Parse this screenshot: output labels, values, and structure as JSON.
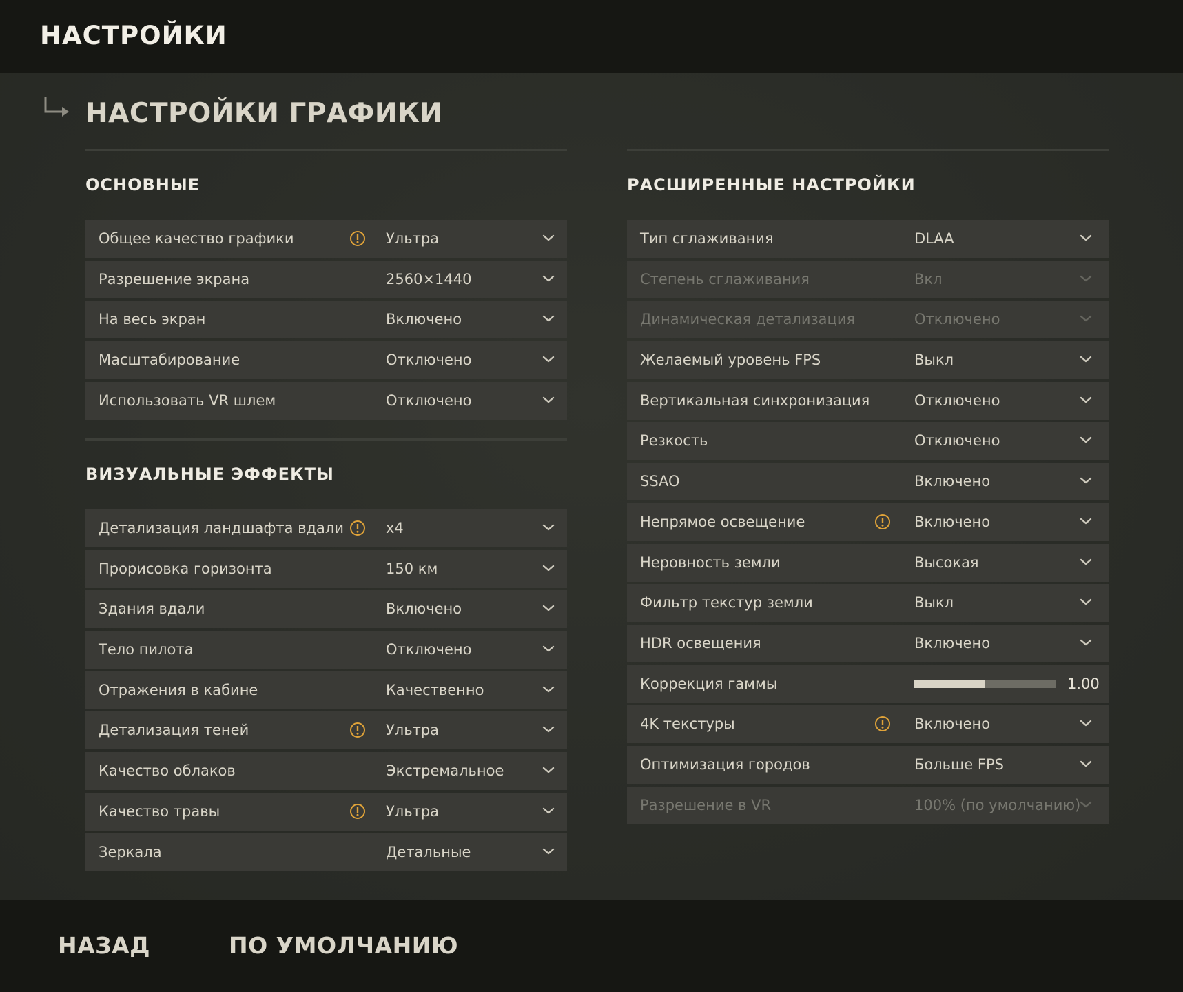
{
  "header": {
    "title": "НАСТРОЙКИ"
  },
  "page": {
    "heading": "НАСТРОЙКИ ГРАФИКИ"
  },
  "colors": {
    "accent_warning": "#e0a339",
    "disabled_text": "#77776f"
  },
  "icons": {
    "breadcrumb": "return-arrow-icon",
    "dropdown": "chevron-down-icon",
    "warning": "warning-icon"
  },
  "basic": {
    "title": "ОСНОВНЫЕ",
    "rows": [
      {
        "label": "Общее качество графики",
        "value": "Ультра",
        "warning": true,
        "disabled": false
      },
      {
        "label": "Разрешение экрана",
        "value": "2560×1440",
        "warning": false,
        "disabled": false
      },
      {
        "label": "На весь экран",
        "value": "Включено",
        "warning": false,
        "disabled": false
      },
      {
        "label": "Масштабирование",
        "value": "Отключено",
        "warning": false,
        "disabled": false
      },
      {
        "label": "Использовать VR шлем",
        "value": "Отключено",
        "warning": false,
        "disabled": false
      }
    ]
  },
  "visual": {
    "title": "ВИЗУАЛЬНЫЕ ЭФФЕКТЫ",
    "rows": [
      {
        "label": "Детализация ландшафта вдали",
        "value": "x4",
        "warning": true,
        "disabled": false
      },
      {
        "label": "Прорисовка горизонта",
        "value": "150 км",
        "warning": false,
        "disabled": false
      },
      {
        "label": "Здания вдали",
        "value": "Включено",
        "warning": false,
        "disabled": false
      },
      {
        "label": "Тело пилота",
        "value": "Отключено",
        "warning": false,
        "disabled": false
      },
      {
        "label": "Отражения в кабине",
        "value": "Качественно",
        "warning": false,
        "disabled": false
      },
      {
        "label": "Детализация теней",
        "value": "Ультра",
        "warning": true,
        "disabled": false
      },
      {
        "label": "Качество облаков",
        "value": "Экстремальное",
        "warning": false,
        "disabled": false
      },
      {
        "label": "Качество травы",
        "value": "Ультра",
        "warning": true,
        "disabled": false
      },
      {
        "label": "Зеркала",
        "value": "Детальные",
        "warning": false,
        "disabled": false
      }
    ]
  },
  "advanced": {
    "title": "РАСШИРЕННЫЕ НАСТРОЙКИ",
    "rows": [
      {
        "label": "Тип сглаживания",
        "value": "DLAA",
        "warning": false,
        "disabled": false
      },
      {
        "label": "Степень сглаживания",
        "value": "Вкл",
        "warning": false,
        "disabled": true
      },
      {
        "label": "Динамическая детализация",
        "value": "Отключено",
        "warning": false,
        "disabled": true
      },
      {
        "label": "Желаемый уровень FPS",
        "value": "Выкл",
        "warning": false,
        "disabled": false
      },
      {
        "label": "Вертикальная синхронизация",
        "value": "Отключено",
        "warning": false,
        "disabled": false
      },
      {
        "label": "Резкость",
        "value": "Отключено",
        "warning": false,
        "disabled": false
      },
      {
        "label": "SSAO",
        "value": "Включено",
        "warning": false,
        "disabled": false
      },
      {
        "label": "Непрямое освещение",
        "value": "Включено",
        "warning": true,
        "disabled": false
      },
      {
        "label": "Неровность земли",
        "value": "Высокая",
        "warning": false,
        "disabled": false
      },
      {
        "label": "Фильтр текстур земли",
        "value": "Выкл",
        "warning": false,
        "disabled": false
      },
      {
        "label": "HDR освещения",
        "value": "Включено",
        "warning": false,
        "disabled": false
      },
      {
        "label": "Коррекция гаммы",
        "value": "1.00",
        "slider": true,
        "slider_fraction": 0.5,
        "warning": false,
        "disabled": false
      },
      {
        "label": "4K текстуры",
        "value": "Включено",
        "warning": true,
        "disabled": false
      },
      {
        "label": "Оптимизация городов",
        "value": "Больше FPS",
        "warning": false,
        "disabled": false
      },
      {
        "label": "Разрешение в VR",
        "value": "100% (по умолчанию)",
        "warning": false,
        "disabled": true
      }
    ]
  },
  "footer": {
    "back_label": "НАЗАД",
    "default_label": "ПО УМОЛЧАНИЮ"
  }
}
